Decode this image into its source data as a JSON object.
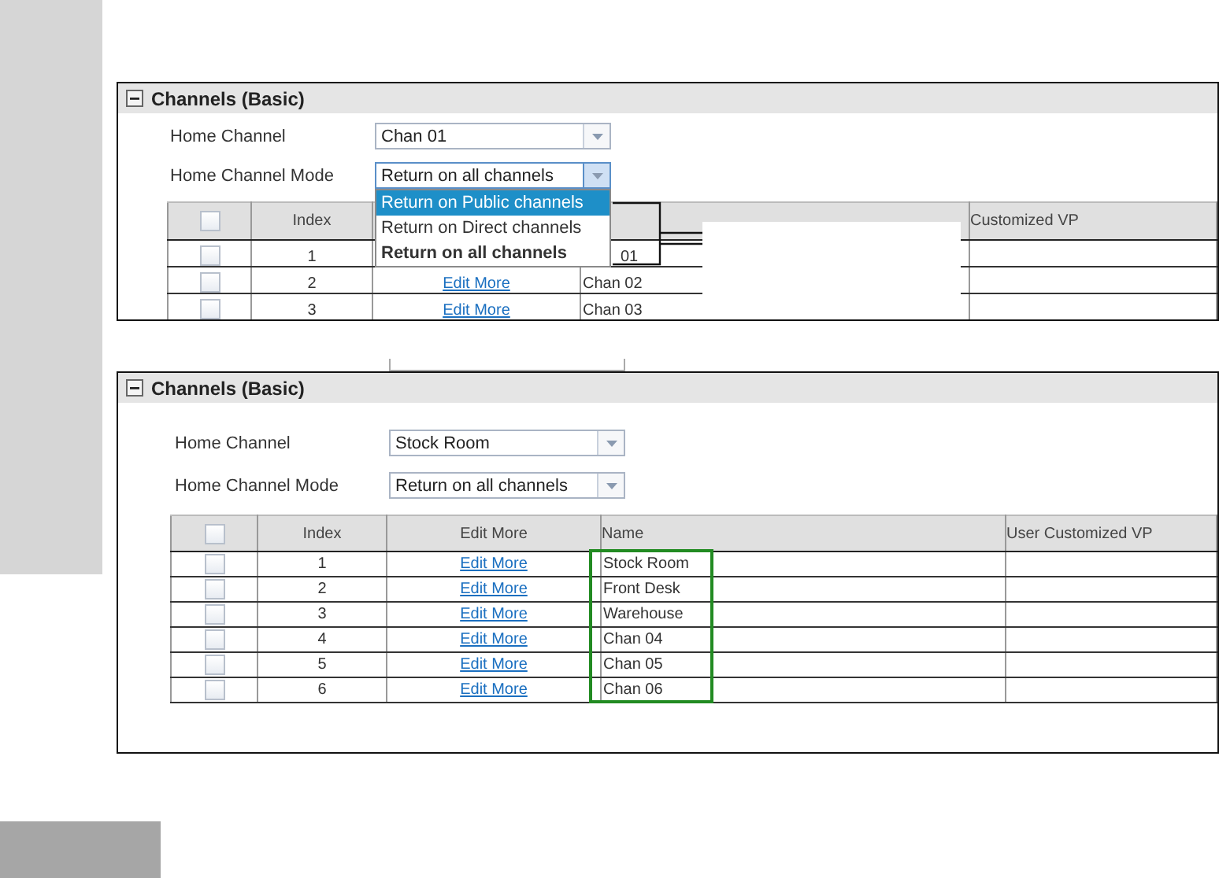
{
  "panels": [
    {
      "title": "Channels (Basic)",
      "expanded": true,
      "home_channel": {
        "label": "Home Channel",
        "value": "Chan 01"
      },
      "mode": {
        "label": "Home Channel Mode",
        "value": "Return on all channels",
        "open": true,
        "options": [
          {
            "label": "Return on Public channels",
            "highlighted": true,
            "selected": false
          },
          {
            "label": "Return on Direct channels",
            "highlighted": false,
            "selected": false
          },
          {
            "label": "Return on all channels",
            "highlighted": false,
            "selected": true
          }
        ]
      },
      "table": {
        "all_checked": false,
        "columns": [
          {},
          {
            "label": "Index"
          },
          {},
          {},
          {
            "label": "Customized VP"
          }
        ],
        "rows": [
          {
            "checked": false,
            "index": "1",
            "name": "01"
          },
          {
            "checked": false,
            "index": "2",
            "edit": "Edit More",
            "name": "Chan 02"
          },
          {
            "checked": false,
            "index": "3",
            "edit": "Edit More",
            "name": "Chan 03"
          }
        ]
      }
    },
    {
      "title": "Channels (Basic)",
      "expanded": true,
      "home_channel": {
        "label": "Home Channel",
        "value": "Stock Room"
      },
      "mode": {
        "label": "Home Channel Mode",
        "value": "Return on all channels",
        "open": false
      },
      "table": {
        "all_checked": false,
        "columns": [
          {},
          {
            "label": "Index"
          },
          {
            "label": "Edit More"
          },
          {
            "label": "Name"
          },
          {
            "label": "User Customized VP"
          }
        ],
        "rows": [
          {
            "checked": false,
            "index": "1",
            "edit": "Edit More",
            "name": "Stock Room"
          },
          {
            "checked": false,
            "index": "2",
            "edit": "Edit More",
            "name": "Front Desk"
          },
          {
            "checked": false,
            "index": "3",
            "edit": "Edit More",
            "name": "Warehouse"
          },
          {
            "checked": false,
            "index": "4",
            "edit": "Edit More",
            "name": "Chan 04"
          },
          {
            "checked": false,
            "index": "5",
            "edit": "Edit More",
            "name": "Chan 05"
          },
          {
            "checked": false,
            "index": "6",
            "edit": "Edit More",
            "name": "Chan 06"
          }
        ]
      }
    }
  ]
}
